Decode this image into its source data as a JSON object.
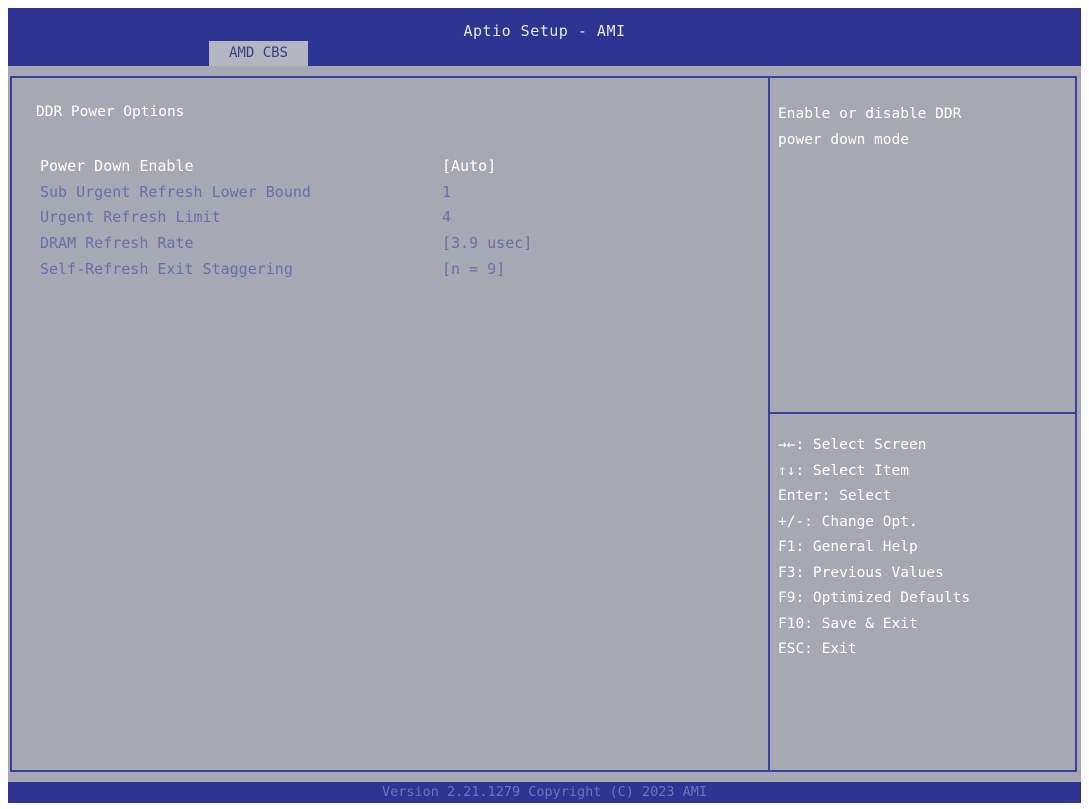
{
  "header": {
    "title": "Aptio Setup - AMI",
    "tab": "AMD CBS"
  },
  "main": {
    "section_title": "DDR Power Options",
    "options": [
      {
        "label": "Power Down Enable",
        "value": "[Auto]",
        "state": "selected"
      },
      {
        "label": "Sub Urgent Refresh Lower Bound",
        "value": "1",
        "state": "disabled"
      },
      {
        "label": "Urgent Refresh Limit",
        "value": "4",
        "state": "disabled"
      },
      {
        "label": "DRAM Refresh Rate",
        "value": "[3.9 usec]",
        "state": "disabled"
      },
      {
        "label": "Self-Refresh Exit Staggering",
        "value": "[n = 9]",
        "state": "disabled"
      }
    ]
  },
  "help": {
    "line1": "Enable or disable DDR",
    "line2": "power down mode"
  },
  "keys": [
    "→←: Select Screen",
    "↑↓: Select Item",
    "Enter: Select",
    "+/-: Change Opt.",
    "F1: General Help",
    "F3: Previous Values",
    "F9: Optimized Defaults",
    "F10: Save & Exit",
    "ESC: Exit"
  ],
  "footer": {
    "text": "Version 2.21.1279 Copyright (C) 2023 AMI"
  },
  "colors": {
    "header_bar": "#2e3492",
    "background": "#a6a9b4",
    "active_text": "#ffffff",
    "disabled_text": "#6a6fa8"
  }
}
